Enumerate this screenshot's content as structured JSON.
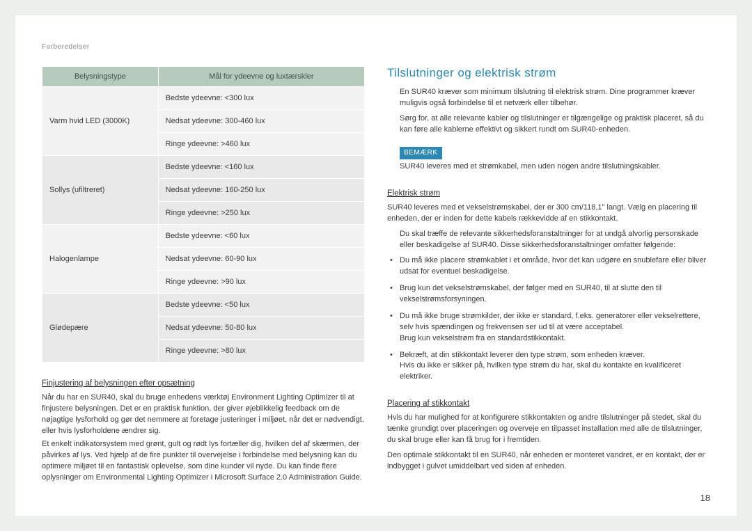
{
  "breadcrumb": "Forberedelser",
  "table": {
    "head1": "Belysningstype",
    "head2": "Mål for ydeevne og luxtærskler",
    "rows": [
      {
        "label": "Varm hvid LED (3000K)",
        "r1": "Bedste ydeevne: <300 lux",
        "r2": "Nedsat ydeevne: 300-460 lux",
        "r3": "Ringe ydeevne: >460 lux"
      },
      {
        "label": "Sollys (ufiltreret)",
        "r1": "Bedste ydeevne: <160 lux",
        "r2": "Nedsat ydeevne: 160-250 lux",
        "r3": "Ringe ydeevne: >250 lux"
      },
      {
        "label": "Halogenlampe",
        "r1": "Bedste ydeevne: <60 lux",
        "r2": "Nedsat ydeevne: 60-90 lux",
        "r3": "Ringe ydeevne: >90 lux"
      },
      {
        "label": "Glødepære",
        "r1": "Bedste ydeevne: <50 lux",
        "r2": "Nedsat ydeevne: 50-80 lux",
        "r3": "Ringe ydeevne: >80 lux"
      }
    ]
  },
  "left": {
    "h1": "Finjustering af belysningen efter opsætning",
    "p1": "Når du har en SUR40, skal du bruge enhedens værktøj Environment Lighting Optimizer til at finjustere belysningen. Det er en praktisk funktion, der giver øjeblikkelig feedback om de nøjagtige lysforhold og gør det nemmere at foretage justeringer i miljøet, når det er nødvendigt, eller hvis lysforholdene ændrer sig.",
    "p2": "Et enkelt indikatorsystem med grønt, gult og rødt lys fortæller dig, hvilken del af skærmen, der påvirkes af lys. Ved hjælp af de fire punkter til overvejelse i forbindelse med belysning kan du optimere miljøet til en fantastisk oplevelse, som dine kunder vil nyde. Du kan finde flere oplysninger om Environmental Lighting Optimizer i Microsoft Surface 2.0 Administration Guide."
  },
  "right": {
    "title": "Tilslutninger og elektrisk strøm",
    "intro1": "En SUR40 kræver som minimum tilslutning til elektrisk strøm. Dine programmer kræver muligvis også forbindelse til et netværk eller tilbehør.",
    "intro2": "Sørg for, at alle relevante kabler og tilslutninger er tilgængelige og praktisk placeret, så du kan føre alle kablerne effektivt og sikkert rundt om SUR40-enheden.",
    "noteBadge": "BEMÆRK",
    "noteText": "SUR40 leveres med et strømkabel, men uden nogen andre tilslutningskabler.",
    "h2": "Elektrisk strøm",
    "elec_p1": "SUR40 leveres med et vekselstrømskabel, der er 300 cm/118,1\" langt. Vælg en placering til enheden, der er inden for dette kabels rækkevidde af en stikkontakt.",
    "elec_p2": "Du skal træffe de relevante sikkerhedsforanstaltninger for at undgå alvorlig personskade eller beskadigelse af SUR40. Disse sikkerhedsforanstaltninger omfatter følgende:",
    "bullets": {
      "b1": "Du må ikke placere strømkablet i et område, hvor det kan udgøre en snublefare eller bliver udsat for eventuel beskadigelse.",
      "b2": "Brug kun det vekselstrømskabel, der følger med en SUR40, til at slutte den til vekselstrømsforsyningen.",
      "b3a": "Du må ikke bruge strømkilder, der ikke er standard, f.eks. generatorer eller vekselrettere, selv hvis spændingen og frekvensen ser ud til at være acceptabel.",
      "b3b": "Brug kun vekselstrøm fra en standardstikkontakt.",
      "b4a": "Bekræft, at din stikkontakt leverer den type strøm, som enheden kræver.",
      "b4b": "Hvis du ikke er sikker på, hvilken type strøm du har, skal du kontakte en kvalificeret elektriker."
    },
    "h3": "Placering af stikkontakt",
    "plac_p1": "Hvis du har mulighed for at konfigurere stikkontakten og andre tilslutninger på stedet, skal du tænke grundigt over placeringen og overveje en tilpasset installation med alle de tilslutninger, du skal bruge eller kan få brug for i fremtiden.",
    "plac_p2": "Den optimale stikkontakt til en SUR40, når enheden er monteret vandret, er en kontakt, der er indbygget i gulvet umiddelbart ved siden af enheden."
  },
  "pageNumber": "18"
}
